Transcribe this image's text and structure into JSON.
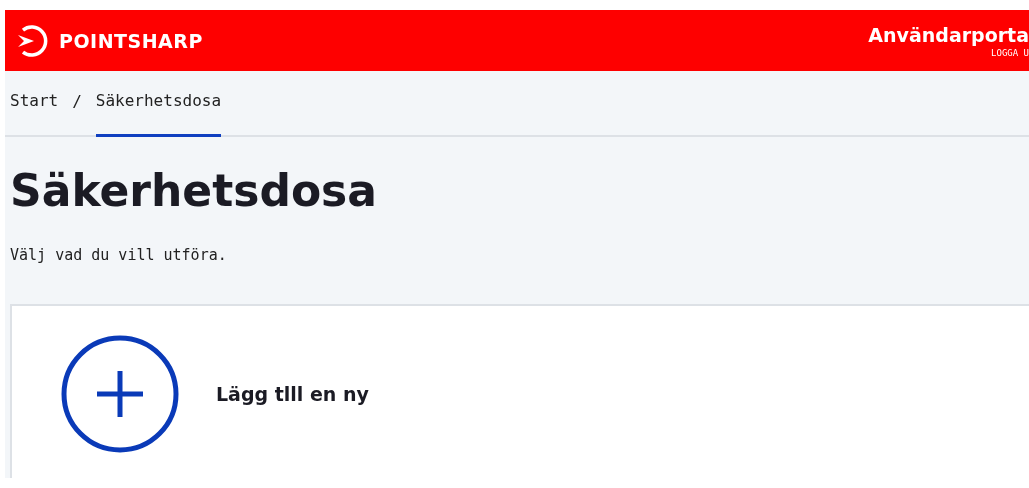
{
  "header": {
    "brand": "POINTSHARP",
    "portal_title": "Användarporta",
    "logout": "LOGGA U"
  },
  "breadcrumb": [
    {
      "label": "Start",
      "selected": false
    },
    {
      "label": "Säkerhetsdosa",
      "selected": true
    }
  ],
  "breadcrumb_separator": "/",
  "page": {
    "title": "Säkerhetsdosa",
    "subtitle": "Välj vad du vill utföra."
  },
  "actions": [
    {
      "label": "Lägg tlll en ny",
      "kind": "add"
    }
  ]
}
